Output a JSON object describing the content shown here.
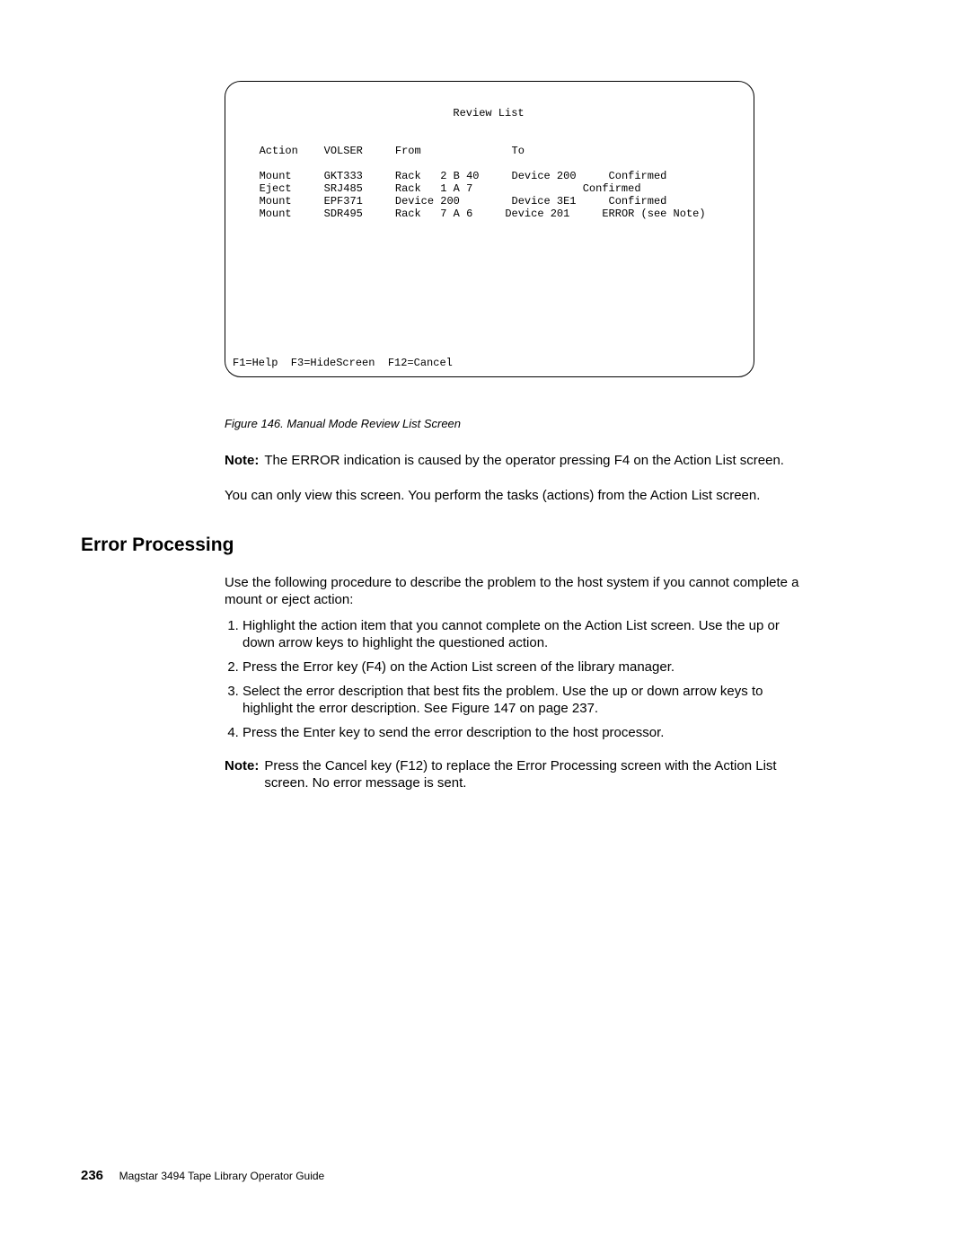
{
  "terminal": {
    "title": "Review List",
    "columns": {
      "c1": "Action",
      "c2": "VOLSER",
      "c3": "From",
      "c4": "To"
    },
    "rows": [
      {
        "action": "Mount",
        "volser": "GKT333",
        "from": "Rack   2 B 40",
        "to": "Device 200",
        "status": "Confirmed"
      },
      {
        "action": "Eject",
        "volser": "SRJ485",
        "from": "Rack   1 A 7",
        "to": "",
        "status": "Confirmed"
      },
      {
        "action": "Mount",
        "volser": "EPF371",
        "from": "Device 200",
        "to": "Device 3E1",
        "status": "Confirmed"
      },
      {
        "action": "Mount",
        "volser": "SDR495",
        "from": "Rack   7 A 6",
        "to": "Device 201",
        "status": "  ERROR (see Note)"
      }
    ],
    "fnkeys": "F1=Help  F3=HideScreen  F12=Cancel"
  },
  "caption": "Figure 146. Manual Mode Review List Screen",
  "note1_label": "Note:",
  "note1_text": "The ERROR indication is caused by the operator pressing F4 on the Action List screen.",
  "para1": "You can only view this screen. You perform the tasks (actions) from the Action List screen.",
  "heading": "Error Processing",
  "para2": "Use the following procedure to describe the problem to the host system if you cannot complete a mount or eject action:",
  "steps": [
    "Highlight the action item that you cannot complete on the Action List screen. Use the up or down arrow keys to highlight the questioned action.",
    "Press the Error key (F4) on the Action List screen of the library manager.",
    "Select the error description that best fits the problem. Use the up or down arrow keys to highlight the error description. See Figure 147 on page 237.",
    "Press the Enter key to send the error description to the host processor."
  ],
  "note2_label": "Note:",
  "note2_text": "Press the Cancel key (F12) to replace the Error Processing screen with the Action List screen. No error message is sent.",
  "page_number": "236",
  "book_title": "Magstar 3494 Tape Library Operator Guide"
}
